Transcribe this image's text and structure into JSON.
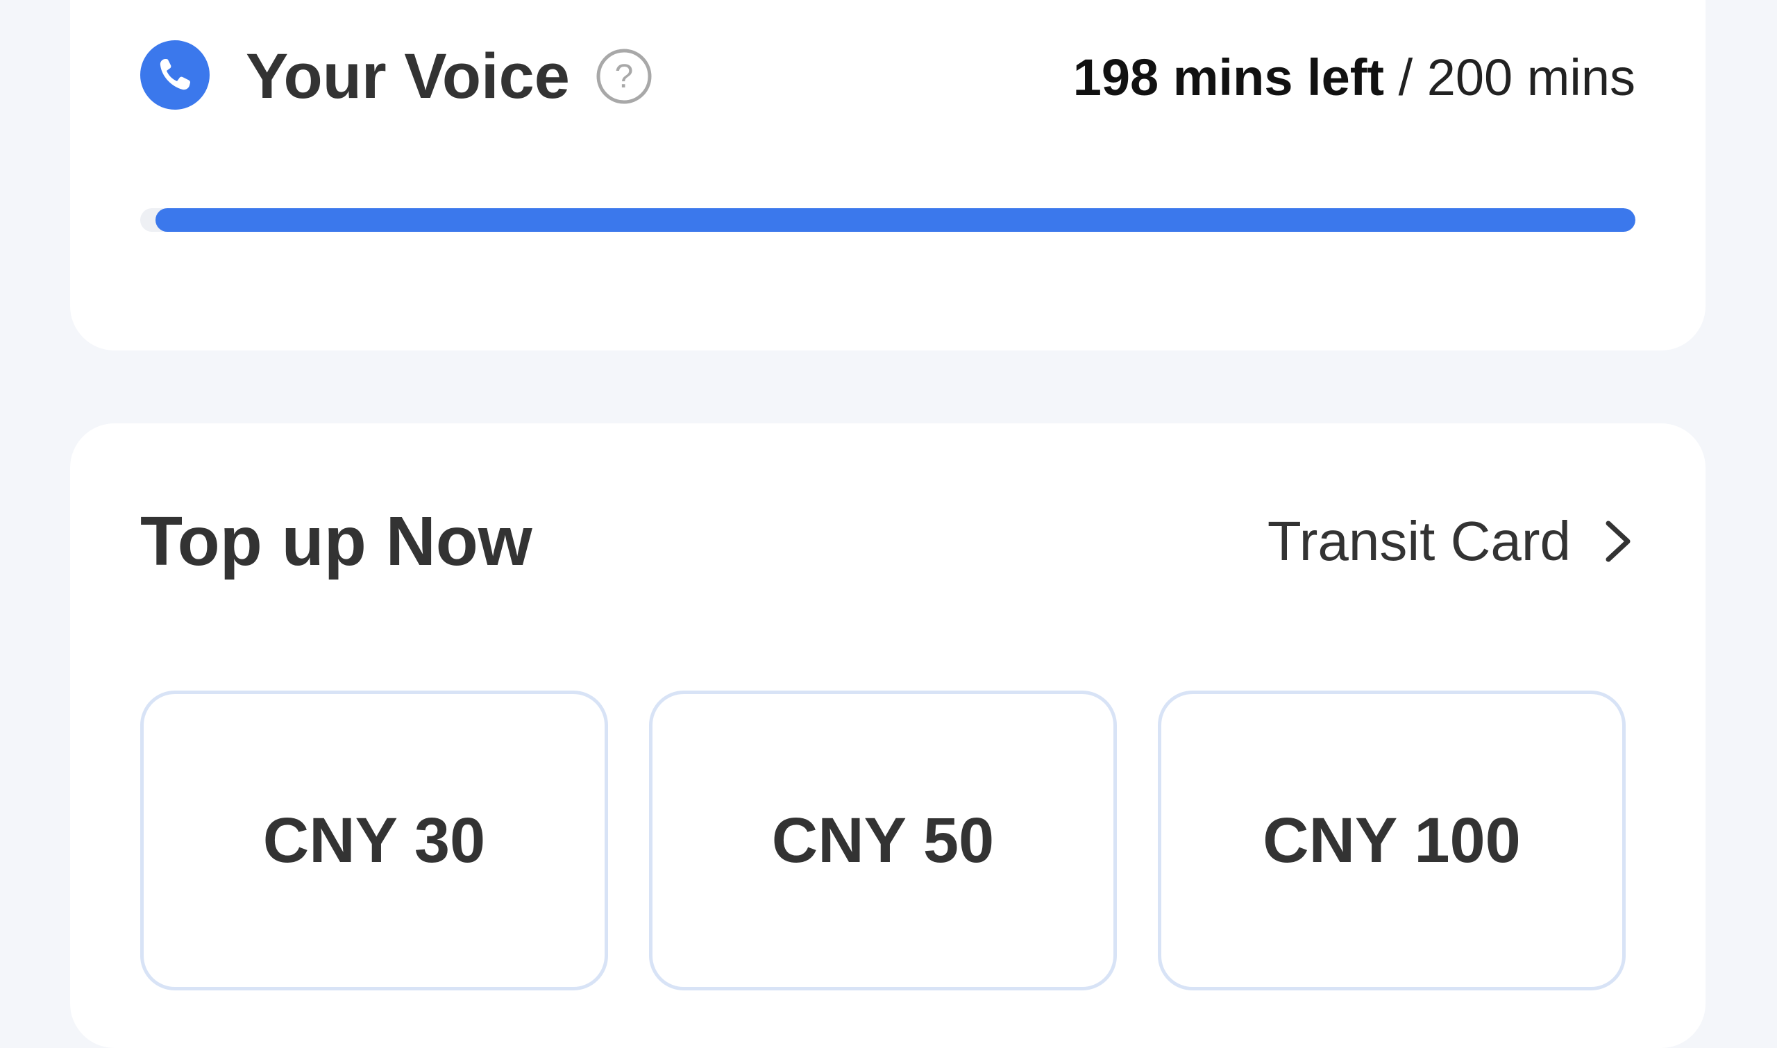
{
  "voice": {
    "title": "Your Voice",
    "remaining_text": "198 mins left",
    "separator": " / ",
    "total_text": "200 mins",
    "remaining_minutes": 198,
    "total_minutes": 200,
    "progress_fraction": 0.99,
    "icons": {
      "phone": "phone-icon",
      "help": "help-icon"
    },
    "accent_color": "#3b78ec"
  },
  "topup": {
    "title": "Top up Now",
    "transit_card_label": "Transit Card",
    "link_icon": "chevron-right-icon",
    "amounts": [
      {
        "label": "CNY 30"
      },
      {
        "label": "CNY 50"
      },
      {
        "label": "CNY 100"
      }
    ]
  },
  "colors": {
    "background": "#f4f6fa",
    "card": "#ffffff",
    "accent": "#3b78ec",
    "tile_border": "#d8e3f6"
  }
}
